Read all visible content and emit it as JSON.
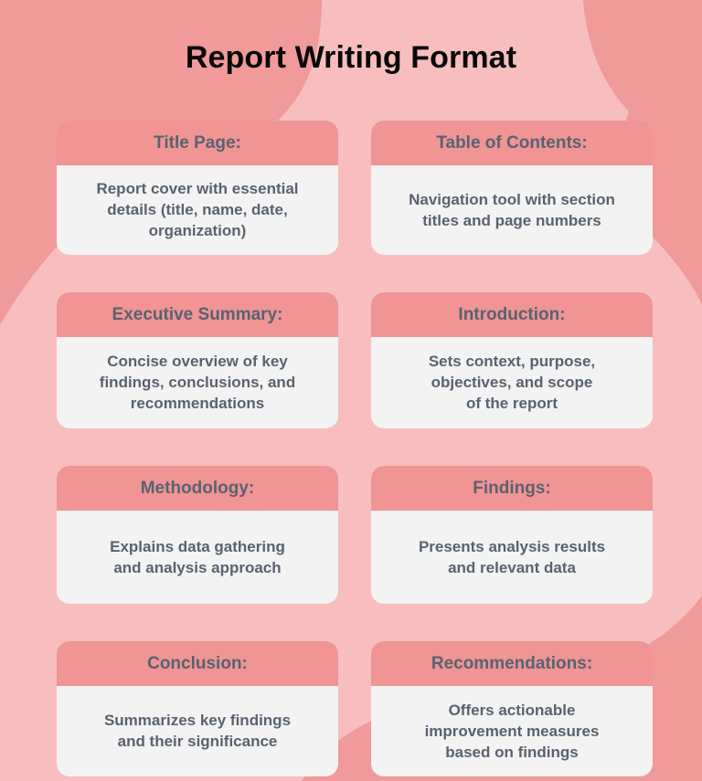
{
  "page": {
    "title": "Report Writing Format",
    "background_color": "#f8bebe",
    "blob_color": "#f09a9a",
    "card_header_color": "#f09494",
    "card_body_color": "#f3f3f3",
    "text_color": "#59626f",
    "title_color": "#080808"
  },
  "cards": [
    {
      "heading": "Title Page:",
      "body": "Report cover with essential\ndetails (title, name, date,\norganization)"
    },
    {
      "heading": "Table of Contents:",
      "body": "Navigation tool with section\ntitles and page numbers"
    },
    {
      "heading": "Executive Summary:",
      "body": "Concise overview of key\nfindings, conclusions, and\nrecommendations"
    },
    {
      "heading": "Introduction:",
      "body": "Sets context, purpose,\nobjectives, and scope\nof the report"
    },
    {
      "heading": "Methodology:",
      "body": "Explains data gathering\nand analysis approach"
    },
    {
      "heading": "Findings:",
      "body": "Presents analysis results\nand relevant data"
    },
    {
      "heading": "Conclusion:",
      "body": "Summarizes key findings\nand their significance"
    },
    {
      "heading": "Recommendations:",
      "body": "Offers actionable\nimprovement measures\nbased on findings"
    }
  ]
}
